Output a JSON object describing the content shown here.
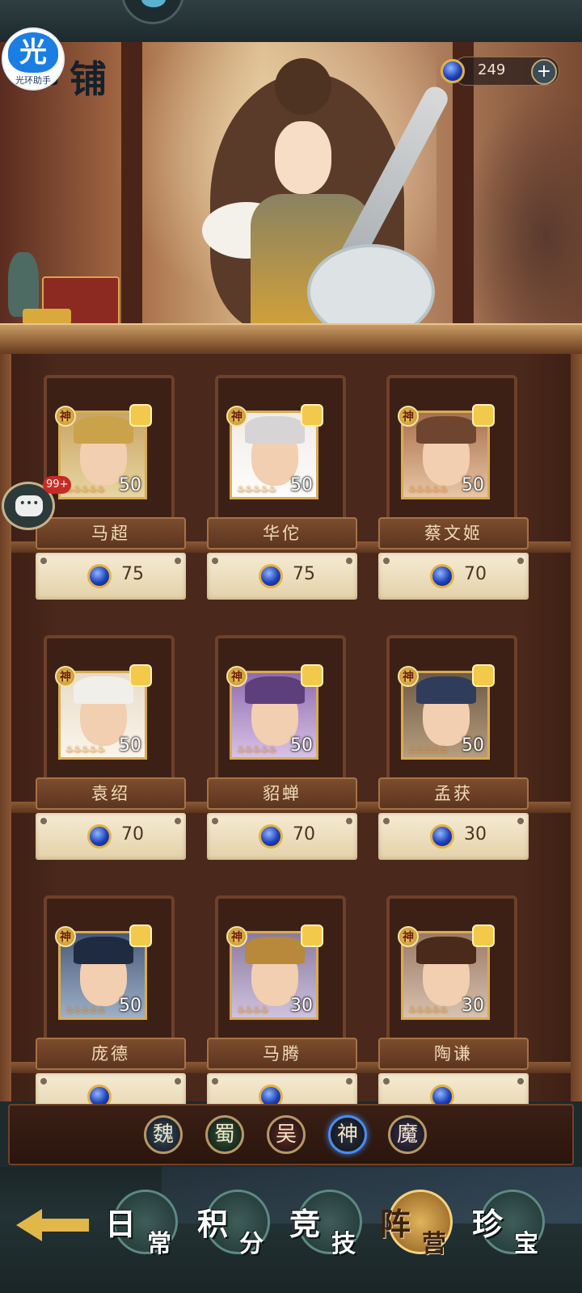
{
  "header": {
    "title_icon": "商",
    "title": "铺",
    "helper_icon": "光",
    "helper_label": "光环助手",
    "currency_icon": "blue-gem-icon",
    "currency_value": "249",
    "add_label": "+"
  },
  "chat": {
    "badge": "99+",
    "icon": "chat-icon"
  },
  "shop_items": [
    {
      "name": "马超",
      "level": "50",
      "stars": 5,
      "badge": "神",
      "price": "75"
    },
    {
      "name": "华佗",
      "level": "50",
      "stars": 5,
      "badge": "神",
      "price": "75"
    },
    {
      "name": "蔡文姬",
      "level": "50",
      "stars": 5,
      "badge": "神",
      "price": "70"
    },
    {
      "name": "袁绍",
      "level": "50",
      "stars": 5,
      "badge": "神",
      "price": "70"
    },
    {
      "name": "貂蝉",
      "level": "50",
      "stars": 5,
      "badge": "神",
      "price": "70"
    },
    {
      "name": "孟获",
      "level": "50",
      "stars": 5,
      "badge": "神",
      "price": "30"
    },
    {
      "name": "庞德",
      "level": "50",
      "stars": 5,
      "badge": "神",
      "price": ""
    },
    {
      "name": "马腾",
      "level": "30",
      "stars": 4,
      "badge": "神",
      "price": ""
    },
    {
      "name": "陶谦",
      "level": "30",
      "stars": 5,
      "badge": "神",
      "price": ""
    }
  ],
  "faction_filters": [
    {
      "label": "魏",
      "color": "#35506a"
    },
    {
      "label": "蜀",
      "color": "#2f5a3c"
    },
    {
      "label": "吴",
      "color": "#6a2a24"
    },
    {
      "label": "神",
      "color": "#283247",
      "active": true
    },
    {
      "label": "魔",
      "color": "#3c3457"
    }
  ],
  "bottom_tabs": [
    {
      "c1": "日",
      "c2": "常"
    },
    {
      "c1": "积",
      "c2": "分"
    },
    {
      "c1": "竞",
      "c2": "技"
    },
    {
      "c1": "阵",
      "c2": "营",
      "active": true
    },
    {
      "c1": "珍",
      "c2": "宝"
    }
  ],
  "colors": {
    "accent": "#e2b74a",
    "gem": "#1d3fb8"
  }
}
